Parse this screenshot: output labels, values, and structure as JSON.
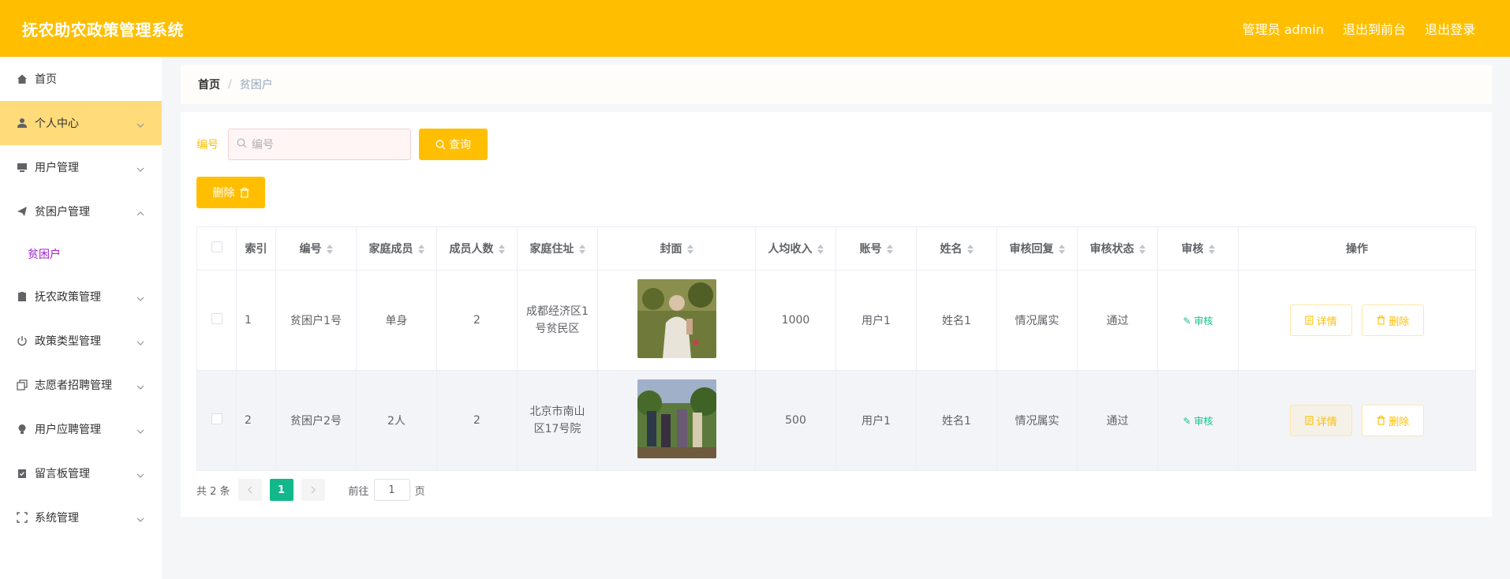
{
  "header": {
    "title": "抚农助农政策管理系统",
    "admin_label": "管理员 admin",
    "front_label": "退出到前台",
    "logout_label": "退出登录"
  },
  "sidebar": {
    "items": [
      {
        "label": "首页",
        "icon": "home-icon"
      },
      {
        "label": "个人中心",
        "icon": "user-icon"
      },
      {
        "label": "用户管理",
        "icon": "desktop-icon"
      },
      {
        "label": "贫困户管理",
        "icon": "plane-icon"
      },
      {
        "label": "抚农政策管理",
        "icon": "clipboard-icon"
      },
      {
        "label": "政策类型管理",
        "icon": "power-icon"
      },
      {
        "label": "志愿者招聘管理",
        "icon": "copy-icon"
      },
      {
        "label": "用户应聘管理",
        "icon": "bulb-icon"
      },
      {
        "label": "留言板管理",
        "icon": "checklist-icon"
      },
      {
        "label": "系统管理",
        "icon": "fullscreen-icon"
      }
    ],
    "sub_item": "贫困户"
  },
  "breadcrumb": {
    "home": "首页",
    "current": "贫困户"
  },
  "search": {
    "label": "编号",
    "placeholder": "编号",
    "button": "查询"
  },
  "delete_button": "删除",
  "table": {
    "headers": [
      "索引",
      "编号",
      "家庭成员",
      "成员人数",
      "家庭住址",
      "封面",
      "人均收入",
      "账号",
      "姓名",
      "审核回复",
      "审核状态",
      "审核",
      "操作"
    ],
    "rows": [
      {
        "index": "1",
        "code": "贫困户1号",
        "members": "单身",
        "count": "2",
        "address": "成都经济区1号贫民区",
        "income": "1000",
        "account": "用户1",
        "name": "姓名1",
        "reply": "情况属实",
        "status": "通过",
        "audit": "审核",
        "detail": "详情",
        "delete": "删除"
      },
      {
        "index": "2",
        "code": "贫困户2号",
        "members": "2人",
        "count": "2",
        "address": "北京市南山区17号院",
        "income": "500",
        "account": "用户1",
        "name": "姓名1",
        "reply": "情况属实",
        "status": "通过",
        "audit": "审核",
        "detail": "详情",
        "delete": "删除"
      }
    ]
  },
  "pager": {
    "total": "共 2 条",
    "current": "1",
    "goto_label": "前往",
    "goto_value": "1",
    "page_suffix": "页"
  },
  "colors": {
    "accent": "#ffbf00",
    "active_menu": "#ffdb7a",
    "pager_active": "#13b88a",
    "audit_link": "#13c48a",
    "sub_item": "#a020d0"
  }
}
